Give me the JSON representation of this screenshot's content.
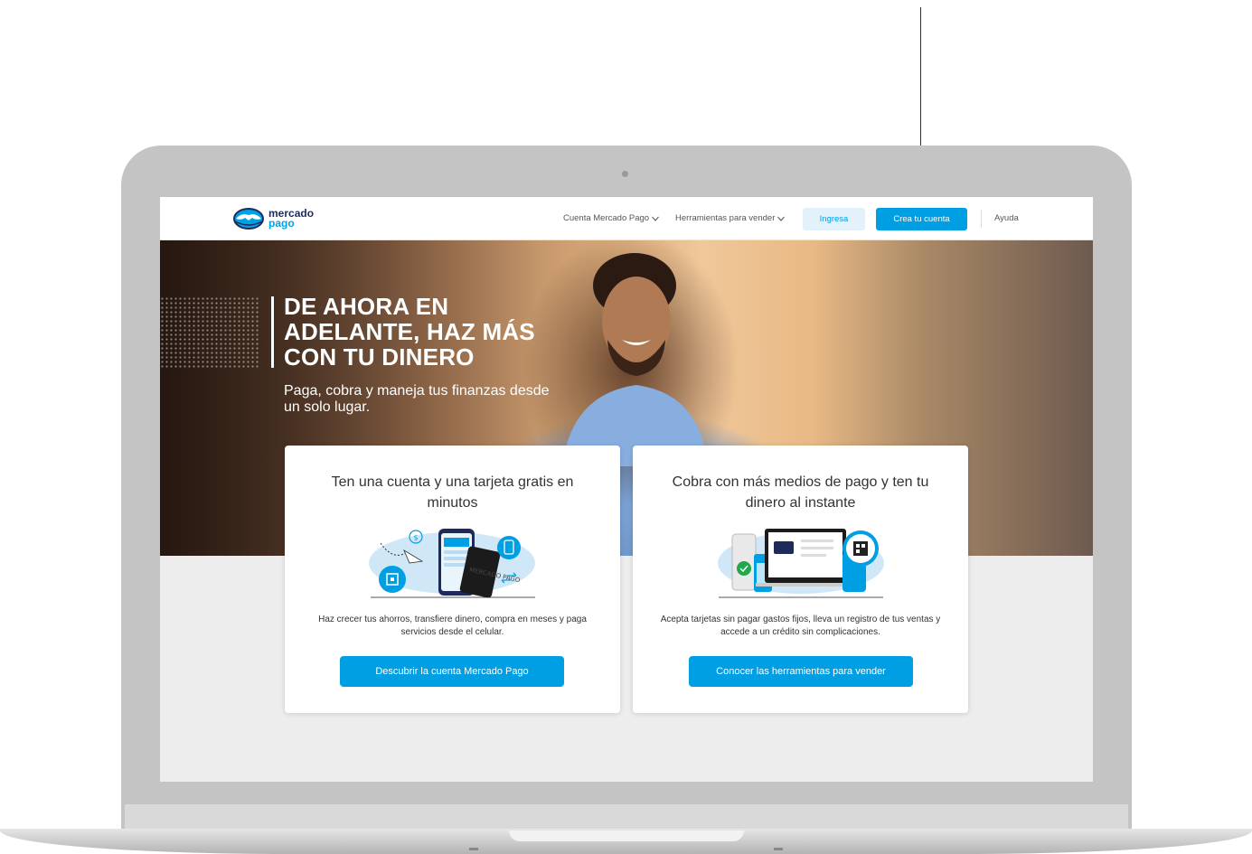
{
  "brand": {
    "name_line1": "mercado",
    "name_line2": "pago",
    "colors": {
      "primary": "#009ee3",
      "navy": "#1f2a5c",
      "light_blue": "#e3f1fb"
    }
  },
  "nav": {
    "cuenta": "Cuenta Mercado Pago",
    "herramientas": "Herramientas para vender",
    "ingresa": "Ingresa",
    "crea": "Crea tu cuenta",
    "ayuda": "Ayuda"
  },
  "hero": {
    "title": "DE AHORA EN ADELANTE, HAZ MÁS CON TU DINERO",
    "subtitle": "Paga, cobra y maneja tus finanzas desde un solo lugar."
  },
  "cards": [
    {
      "title": "Ten una cuenta y una tarjeta gratis en minutos",
      "description": "Haz crecer tus ahorros, transfiere dinero, compra en meses y paga servicios desde el celular.",
      "button": "Descubrir la cuenta Mercado Pago",
      "illustration_card_text": "MERCADO PAGO"
    },
    {
      "title": "Cobra con más medios de pago y ten tu dinero al instante",
      "description": "Acepta tarjetas sin pagar gastos fijos, lleva un registro de tus ventas y accede a un crédito sin complicaciones.",
      "button": "Conocer las herramientas para vender"
    }
  ]
}
